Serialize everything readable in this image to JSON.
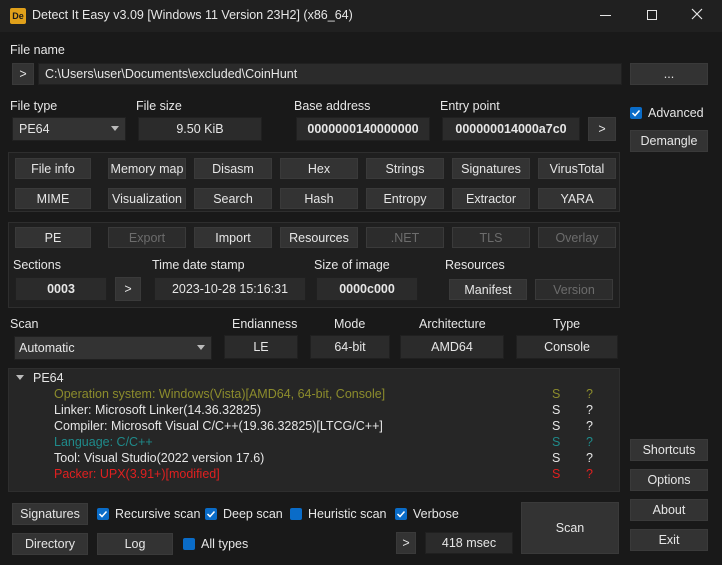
{
  "window": {
    "title": "Detect It Easy v3.09 [Windows 11 Version 23H2] (x86_64)"
  },
  "file": {
    "label": "File name",
    "browse_label": ">",
    "path": "C:\\Users\\user\\Documents\\excluded\\CoinHunt",
    "more_label": "..."
  },
  "info": {
    "file_type_label": "File type",
    "file_type_value": "PE64",
    "file_size_label": "File size",
    "file_size_value": "9.50 KiB",
    "base_address_label": "Base address",
    "base_address_value": "0000000140000000",
    "entry_point_label": "Entry point",
    "entry_point_value": "000000014000a7c0",
    "entry_go_label": ">"
  },
  "side": {
    "advanced_label": "Advanced",
    "advanced_checked": true,
    "demangle_label": "Demangle",
    "shortcuts_label": "Shortcuts",
    "options_label": "Options",
    "about_label": "About",
    "exit_label": "Exit"
  },
  "tools": {
    "row1": [
      "File info",
      "Memory map",
      "Disasm",
      "Hex",
      "Strings",
      "Signatures",
      "VirusTotal"
    ],
    "row2": [
      "MIME",
      "Visualization",
      "Search",
      "Hash",
      "Entropy",
      "Extractor",
      "YARA"
    ]
  },
  "pe": {
    "tabs": [
      "PE",
      "Export",
      "Import",
      "Resources",
      ".NET",
      "TLS",
      "Overlay"
    ],
    "sections_label": "Sections",
    "sections_value": "0003",
    "sections_go": ">",
    "timestamp_label": "Time date stamp",
    "timestamp_value": "2023-10-28 15:16:31",
    "size_image_label": "Size of image",
    "size_image_value": "0000c000",
    "resources_label": "Resources",
    "manifest_label": "Manifest",
    "version_label": "Version"
  },
  "scan": {
    "label": "Scan",
    "mode_value": "Automatic",
    "endianness_label": "Endianness",
    "endianness_value": "LE",
    "mode_label": "Mode",
    "mode_bits_value": "64-bit",
    "architecture_label": "Architecture",
    "architecture_value": "AMD64",
    "type_label": "Type",
    "type_value": "Console"
  },
  "results": {
    "root": "PE64",
    "rows": [
      {
        "text": "Operation system: Windows(Vista)[AMD64, 64-bit, Console]",
        "s": "S",
        "q": "?",
        "color": "#8c8c2c"
      },
      {
        "text": "Linker: Microsoft Linker(14.36.32825)",
        "s": "S",
        "q": "?",
        "color": "#e6e6e6"
      },
      {
        "text": "Compiler: Microsoft Visual C/C++(19.36.32825)[LTCG/C++]",
        "s": "S",
        "q": "?",
        "color": "#e6e6e6"
      },
      {
        "text": "Language: C/C++",
        "s": "S",
        "q": "?",
        "color": "#1f8a8a"
      },
      {
        "text": "Tool: Visual Studio(2022 version 17.6)",
        "s": "S",
        "q": "?",
        "color": "#e6e6e6"
      },
      {
        "text": "Packer: UPX(3.91+)[modified]",
        "s": "S",
        "q": "?",
        "color": "#e02020"
      }
    ]
  },
  "bottom": {
    "signatures_label": "Signatures",
    "directory_label": "Directory",
    "log_label": "Log",
    "recursive_label": "Recursive scan",
    "recursive_checked": true,
    "deep_label": "Deep scan",
    "deep_checked": true,
    "heuristic_label": "Heuristic scan",
    "heuristic_checked": false,
    "verbose_label": "Verbose",
    "verbose_checked": true,
    "alltypes_label": "All types",
    "alltypes_checked": false,
    "more_label": ">",
    "time_value": "418 msec",
    "scan_label": "Scan"
  }
}
